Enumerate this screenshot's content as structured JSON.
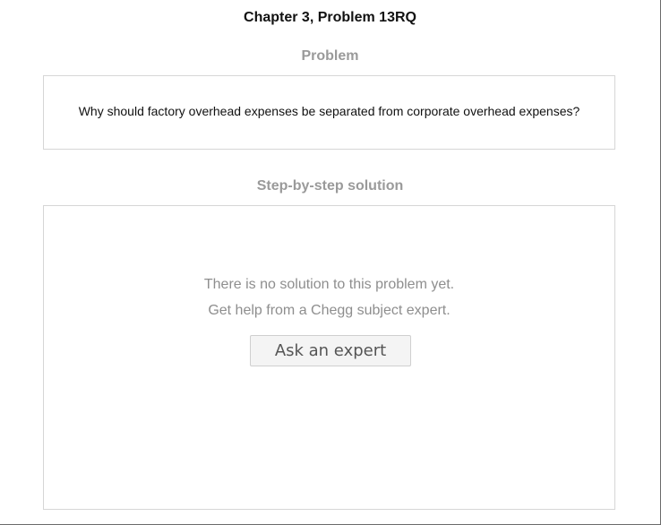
{
  "header": {
    "title": "Chapter 3, Problem 13RQ"
  },
  "problem": {
    "heading": "Problem",
    "text": "Why should factory overhead expenses be separated from corporate overhead expenses?"
  },
  "solution": {
    "heading": "Step-by-step solution",
    "empty_line_1": "There is no solution to this problem yet.",
    "empty_line_2": "Get help from a Chegg subject expert.",
    "ask_button_label": "Ask an expert"
  },
  "colors": {
    "heading_gray": "#9a9a9a",
    "panel_border": "#d6d6d6",
    "button_bg": "#f4f4f4"
  }
}
